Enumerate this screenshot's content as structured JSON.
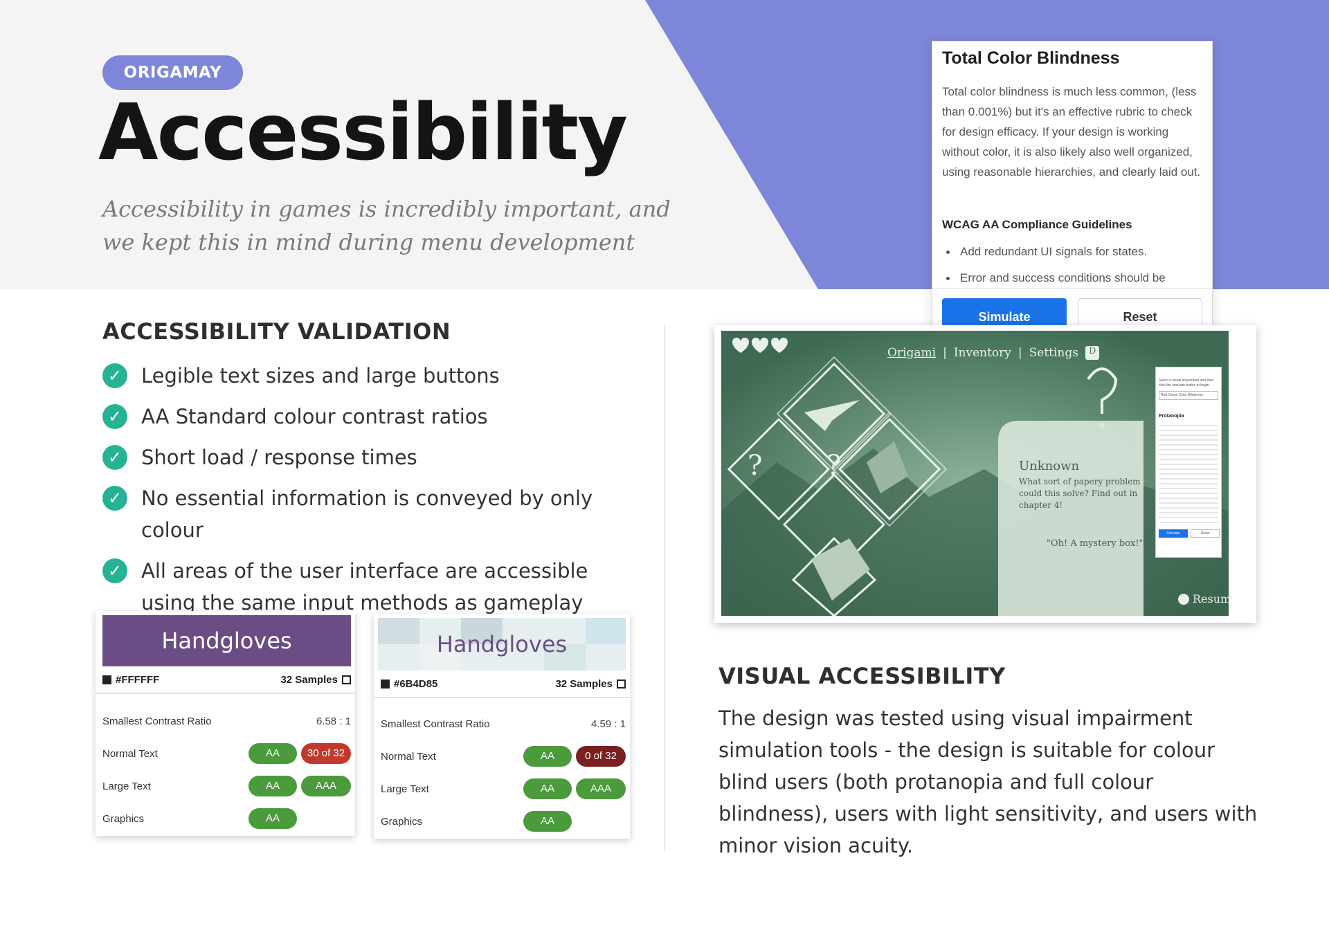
{
  "hero": {
    "badge": "ORIGAMAY",
    "title": "Accessibility",
    "subtitle": "Accessibility in games is incredibly important, and we kept this in mind during menu development"
  },
  "popup": {
    "title": "Total Color Blindness",
    "body": "Total color blindness is much less common, (less than 0.001%) but it's an effective rubric to check for design efficacy. If your design is working without color, it is also likely also well organized, using reasonable hierarchies, and clearly laid out.",
    "heading": "WCAG AA Compliance Guidelines",
    "items": [
      "Add redundant UI signals for states.",
      "Error and success conditions should be"
    ],
    "simulate_label": "Simulate",
    "reset_label": "Reset"
  },
  "validation": {
    "heading": "ACCESSIBILITY VALIDATION",
    "items": [
      "Legible text sizes and large buttons",
      "AA Standard colour contrast ratios",
      "Short load / response times",
      "No essential information is conveyed by only colour",
      "All areas of the user interface are accessible using the same input methods as gameplay"
    ]
  },
  "cards": [
    {
      "sample_text": "Handgloves",
      "color_code": "#FFFFFF",
      "samples": "32 Samples",
      "ratio_label": "Smallest Contrast Ratio",
      "ratio_value": "6.58 : 1",
      "rows": [
        {
          "label": "Normal Text",
          "b1": "AA",
          "b2": "30 of 32"
        },
        {
          "label": "Large Text",
          "b1": "AA",
          "b2": "AAA"
        },
        {
          "label": "Graphics",
          "b1": "AA",
          "b2": ""
        }
      ]
    },
    {
      "sample_text": "Handgloves",
      "color_code": "#6B4D85",
      "samples": "32 Samples",
      "ratio_label": "Smallest Contrast Ratio",
      "ratio_value": "4.59 : 1",
      "rows": [
        {
          "label": "Normal Text",
          "b1": "AA",
          "b2": "0 of 32"
        },
        {
          "label": "Large Text",
          "b1": "AA",
          "b2": "AAA"
        },
        {
          "label": "Graphics",
          "b1": "AA",
          "b2": ""
        }
      ]
    }
  ],
  "game": {
    "nav": [
      "Origami",
      "Inventory",
      "Settings",
      "D"
    ],
    "unknown_title": "Unknown",
    "unknown_desc": "What sort of papery problem could this solve? Find out in chapter 4!",
    "quote": "\"Oh! A mystery box!\"",
    "resume": "Resume",
    "mini_panel": {
      "intro": "Select a visual impairment and then click the simulate button to begin.",
      "select": "Red Green Color Blindness",
      "heading": "Protanopia",
      "simulate": "Simulate",
      "reset": "Reset"
    }
  },
  "visual": {
    "heading": "VISUAL ACCESSIBILITY",
    "body": "The design was tested using visual impairment simulation tools - the design is suitable for colour blind users (both protanopia and full colour blindness), users with light sensitivity, and users with minor vision acuity."
  },
  "colors": {
    "accent": "#7d86d9",
    "check": "#25b394",
    "simulate": "#1a73e8",
    "pass": "#4b9a3b",
    "fail": "#c0392b",
    "swatch1": "#6b4d85"
  }
}
